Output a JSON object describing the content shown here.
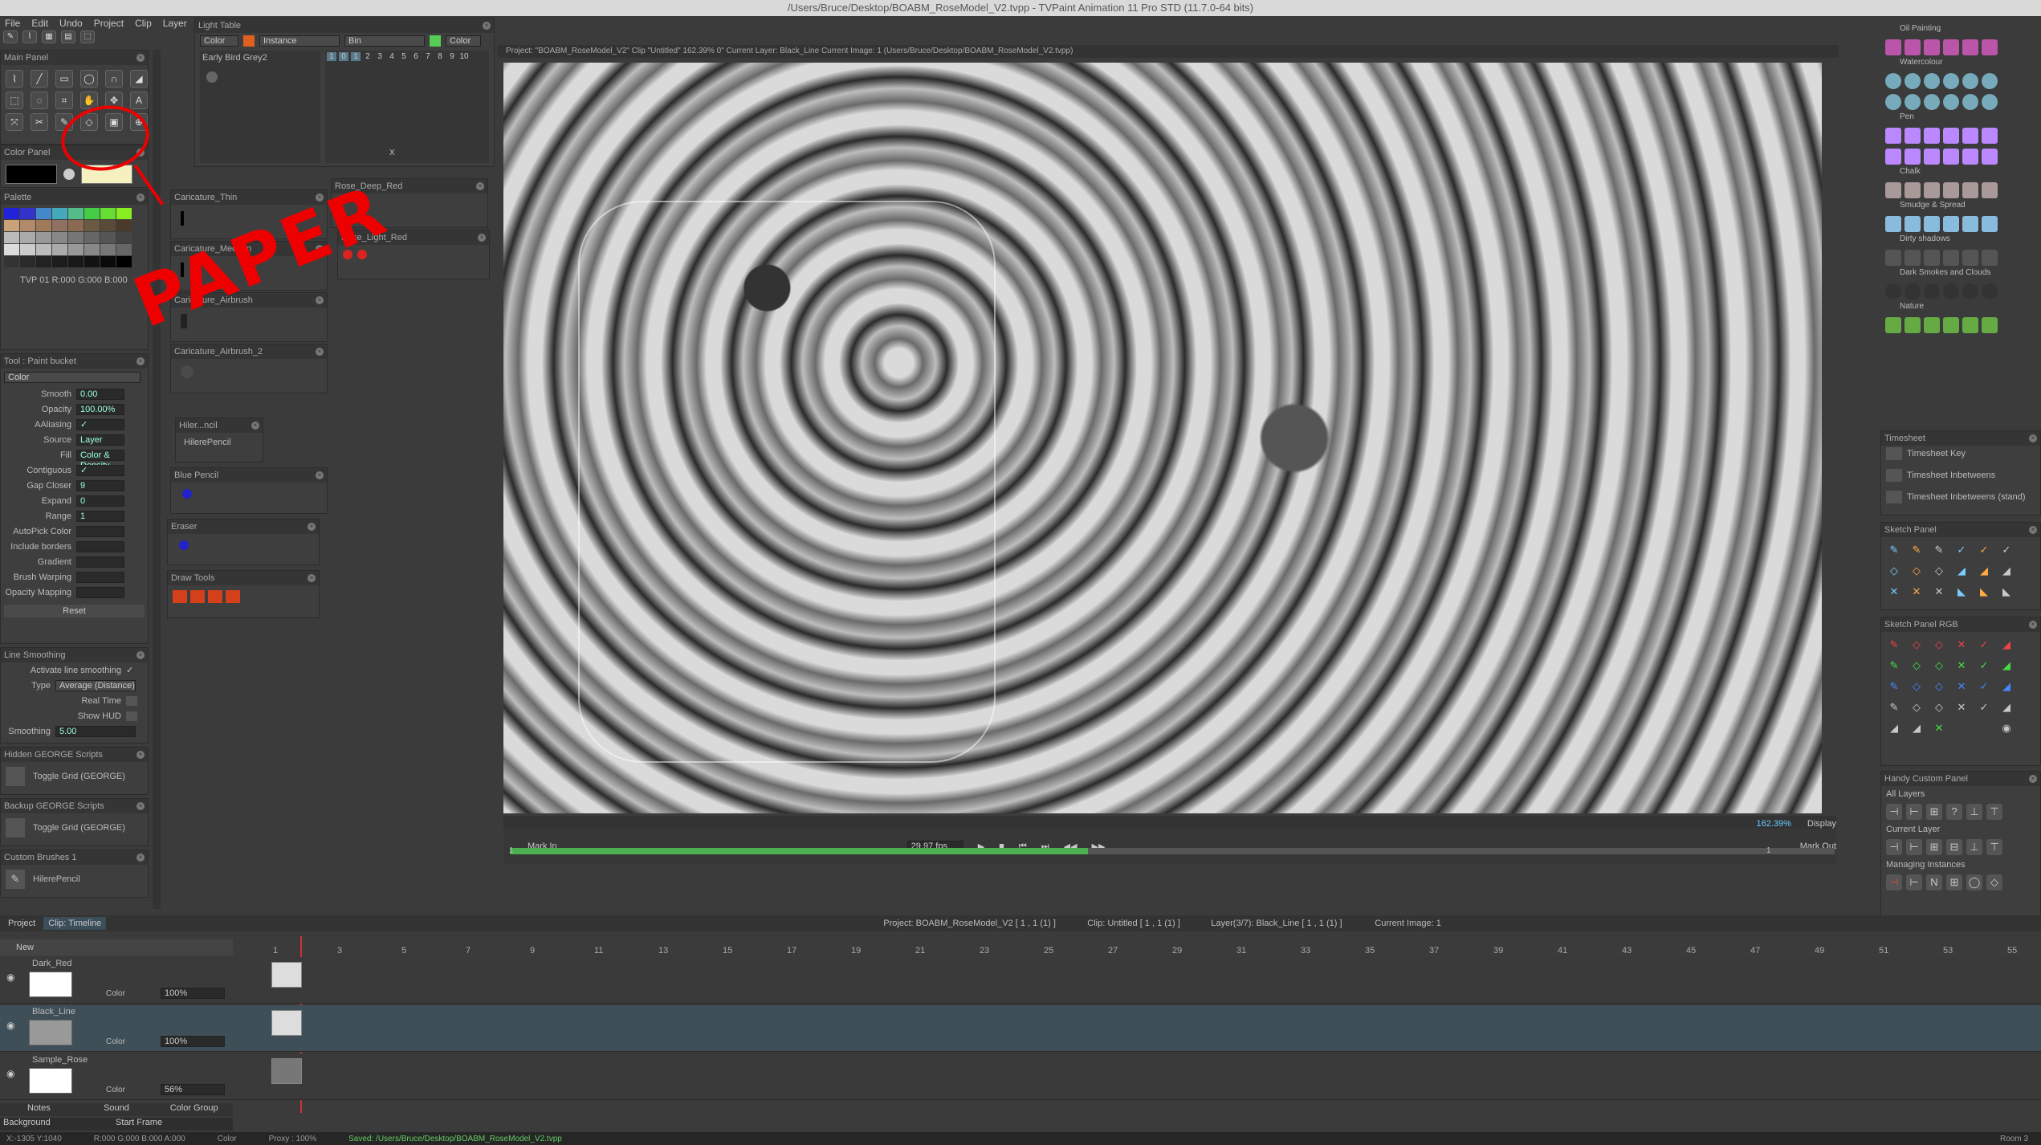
{
  "window": {
    "title": "/Users/Bruce/Desktop/BOABM_RoseModel_V2.tvpp - TVPaint Animation 11 Pro STD (11.7.0-64 bits)"
  },
  "menu": [
    "File",
    "Edit",
    "Undo",
    "Project",
    "Clip",
    "Layer"
  ],
  "light_table": {
    "title": "Light Table",
    "color": "Color",
    "instance": "Instance",
    "bin": "Bin",
    "color2": "Color",
    "layer": "Early Bird Grey2",
    "ticks": [
      "1",
      "0",
      "1",
      "2",
      "3",
      "4",
      "5",
      "6",
      "7",
      "8",
      "9",
      "10"
    ],
    "x_marker": "X"
  },
  "main_panel": {
    "title": "Main Panel"
  },
  "color_panel": {
    "title": "Color Panel"
  },
  "palette": {
    "title": "Palette",
    "status": "TVP 01 R:000 G:000 B:000"
  },
  "tool_panel": {
    "title": "Tool : Paint bucket",
    "mode": "Color",
    "fields": [
      {
        "label": "Smooth",
        "value": "0.00"
      },
      {
        "label": "Opacity",
        "value": "100.00%"
      },
      {
        "label": "AAliasing",
        "value": "✓"
      },
      {
        "label": "Source",
        "value": "Layer"
      },
      {
        "label": "Fill",
        "value": "Color & Density"
      },
      {
        "label": "Contiguous",
        "value": "✓"
      },
      {
        "label": "Gap Closer",
        "value": "9"
      },
      {
        "label": "Expand",
        "value": "0"
      },
      {
        "label": "Range",
        "value": "1"
      },
      {
        "label": "AutoPick Color",
        "value": ""
      },
      {
        "label": "Include borders",
        "value": ""
      },
      {
        "label": "Gradient",
        "value": ""
      },
      {
        "label": "Brush Warping",
        "value": ""
      },
      {
        "label": "Opacity Mapping",
        "value": ""
      }
    ],
    "reset": "Reset"
  },
  "line_smoothing": {
    "title": "Line Smoothing",
    "activate": "Activate line smoothing",
    "type_label": "Type",
    "type_value": "Average (Distance)",
    "real_time": "Real Time",
    "show_hud": "Show HUD",
    "smoothing_label": "Smoothing",
    "smoothing_value": "5.00"
  },
  "hidden_george": {
    "title": "Hidden GEORGE Scripts",
    "item": "Toggle Grid (GEORGE)"
  },
  "backup_george": {
    "title": "Backup GEORGE Scripts",
    "item": "Toggle Grid (GEORGE)"
  },
  "custom_brushes": {
    "title": "Custom Brushes 1",
    "item": "HilerePencil"
  },
  "brush_bins": [
    {
      "name": "Caricature_Thin"
    },
    {
      "name": "Caricature_Medium"
    },
    {
      "name": "Caricature_Airbrush"
    },
    {
      "name": "Caricature_Airbrush_2"
    },
    {
      "name": "Hiler...ncil",
      "item": "HilerePencil"
    },
    {
      "name": "Blue Pencil"
    },
    {
      "name": "Eraser"
    },
    {
      "name": "Draw Tools"
    }
  ],
  "brush_bins_right": [
    {
      "name": "Rose_Deep_Red"
    },
    {
      "name": "Rose_Light_Red"
    }
  ],
  "canvas_header": "Project: \"BOABM_RoseModel_V2\" Clip \"Untitled\"  162.39%  0\"  Current Layer: Black_Line  Current Image: 1 (Users/Bruce/Desktop/BOABM_RoseModel_V2.tvpp)",
  "playback": {
    "mark_in": "Mark In",
    "fps": "29.97 fps",
    "zoom": "162.39%",
    "display": "Display",
    "mark_out": "Mark Out",
    "frame_start": "1",
    "frame_end": "1"
  },
  "annotation": "PAPER",
  "right_panel": {
    "sections": [
      "Oil Painting",
      "Watercolour",
      "Pen",
      "Chalk",
      "Smudge & Spread",
      "Dirty shadows",
      "Dark Smokes and Clouds",
      "Nature"
    ],
    "timesheet": {
      "title": "Timesheet",
      "items": [
        "Timesheet Key",
        "Timesheet Inbetweens",
        "Timesheet Inbetweens (stand)"
      ]
    },
    "sketch_panel": "Sketch Panel",
    "sketch_panel_rgb": "Sketch Panel RGB",
    "handy": {
      "title": "Handy Custom Panel",
      "all_layers": "All Layers",
      "current_layer": "Current Layer",
      "managing": "Managing Instances"
    }
  },
  "timeline": {
    "tabs": [
      "Project",
      "Clip: Timeline"
    ],
    "info": {
      "project": "Project: BOABM_RoseModel_V2 [ 1 , 1 (1) ]",
      "clip": "Clip: Untitled [ 1 , 1 (1) ]",
      "layer": "Layer(3/7): Black_Line [ 1 , 1 (1) ]",
      "image": "Current Image: 1"
    },
    "new_label": "New",
    "frame_numbers": [
      "1",
      "3",
      "5",
      "7",
      "9",
      "11",
      "13",
      "15",
      "17",
      "19",
      "21",
      "23",
      "25",
      "27",
      "29",
      "31",
      "33",
      "35",
      "37",
      "39",
      "41",
      "43",
      "45",
      "47",
      "49",
      "51",
      "53",
      "55"
    ],
    "layers": [
      {
        "name": "Dark_Red",
        "blend": "Color",
        "opacity": "100%"
      },
      {
        "name": "Black_Line",
        "blend": "Color",
        "opacity": "100%"
      },
      {
        "name": "Sample_Rose",
        "blend": "Color",
        "opacity": "56%"
      }
    ],
    "bottom_tabs": [
      "Notes",
      "Sound",
      "Color Group"
    ],
    "background": "Background",
    "start_frame": "Start Frame"
  },
  "statusbar": {
    "coords": "X:-1305  Y:1040",
    "rgba": "R:000 G:000 B:000 A:000",
    "mode": "Color",
    "proxy": "Proxy : 100%",
    "saved": "Saved: /Users/Bruce/Desktop/BOABM_RoseModel_V2.tvpp",
    "room": "Room 3"
  },
  "colors": {
    "accent_green": "#4caf50",
    "swatch_fg": "#000000",
    "swatch_bg": "#f4f0c0",
    "annotation_red": "#e00000"
  }
}
